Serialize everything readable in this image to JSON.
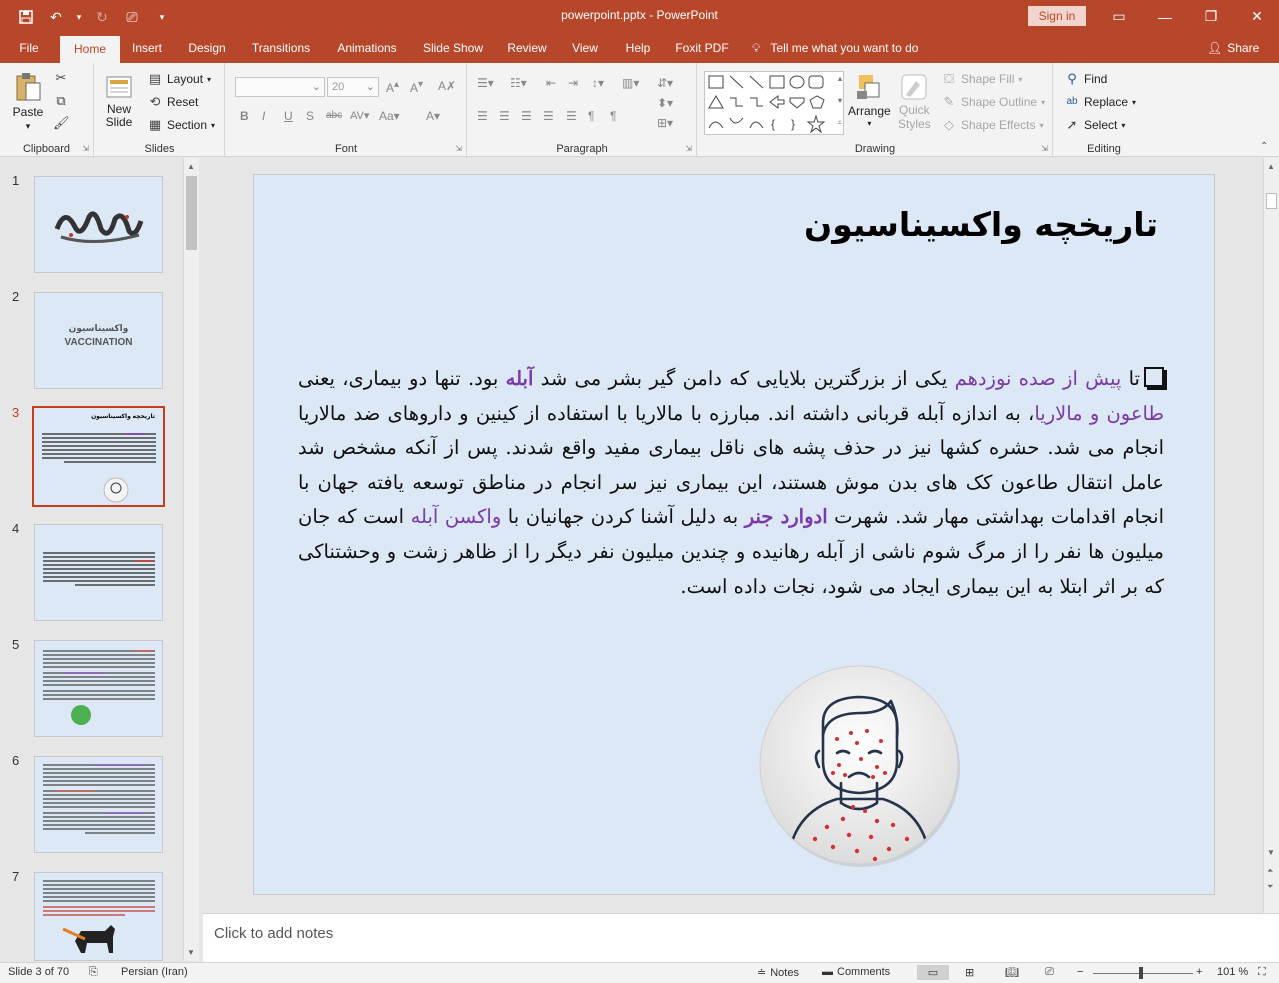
{
  "window": {
    "title": "powerpoint.pptx  -  PowerPoint",
    "signin_label": "Sign in"
  },
  "tabs": [
    "File",
    "Home",
    "Insert",
    "Design",
    "Transitions",
    "Animations",
    "Slide Show",
    "Review",
    "View",
    "Help",
    "Foxit PDF"
  ],
  "active_tab": "Home",
  "tellme": "Tell me what you want to do",
  "share_label": "Share",
  "ribbon": {
    "clipboard": {
      "label": "Clipboard",
      "paste": "Paste"
    },
    "slides": {
      "label": "Slides",
      "new_slide_1": "New",
      "new_slide_2": "Slide",
      "layout": "Layout",
      "reset": "Reset",
      "section": "Section"
    },
    "font": {
      "label": "Font",
      "font_name": "",
      "font_size": "20"
    },
    "paragraph": {
      "label": "Paragraph"
    },
    "drawing": {
      "label": "Drawing",
      "arrange": "Arrange",
      "quick_styles_1": "Quick",
      "quick_styles_2": "Styles",
      "shape_fill": "Shape Fill",
      "shape_outline": "Shape Outline",
      "shape_effects": "Shape Effects"
    },
    "editing": {
      "label": "Editing",
      "find": "Find",
      "replace": "Replace",
      "select": "Select"
    }
  },
  "thumbnails": [
    {
      "num": "1",
      "text": ""
    },
    {
      "num": "2",
      "text1": "واکسیناسیون",
      "text2": "VACCINATION"
    },
    {
      "num": "3",
      "text": "تاریخچه واکسیناسیون"
    },
    {
      "num": "4"
    },
    {
      "num": "5"
    },
    {
      "num": "6"
    },
    {
      "num": "7"
    }
  ],
  "selected_slide": "3",
  "slide": {
    "title": "تاریخچه واکسیناسیون",
    "body": {
      "p1": "تا ",
      "h1": "پیش از صده نوزدهم",
      "p2": " یکی از بزرگترین بلایایی که دامن گیر بشر می شد ",
      "h2": "آبله",
      "p3": " بود. تنها دو بیماری، یعنی ",
      "h3": "طاعون و مالاریا",
      "p4": "، به اندازه آبله قربانی داشته اند. مبارزه با مالاریا با استفاده از کینین و داروهای ضد مالاریا انجام می شد. حشره کشها نیز در حذف پشه های ناقل بیماری مفید واقع شدند. پس از آنکه مشخص شد عامل انتقال طاعون کک های بدن موش هستند، این بیماری نیز سر انجام در مناطق توسعه یافته جهان با انجام اقدامات بهداشتی مهار شد. شهرت ",
      "h4": "ادوارد جنر",
      "p5": " به دلیل آشنا کردن جهانیان با ",
      "h5": "واکسن آبله",
      "p6": " است که جان میلیون ها نفر را از مرگ شوم ناشی از آبله رهانیده و چندین میلیون نفر دیگر را از ظاهر زشت و وحشتناکی که بر اثر ابتلا به این بیماری ایجاد می شود، نجات داده است."
    }
  },
  "notes_placeholder": "Click to add notes",
  "status": {
    "slide_of": "Slide 3 of 70",
    "language": "Persian (Iran)",
    "notes": "Notes",
    "comments": "Comments",
    "zoom": "101 %"
  },
  "colors": {
    "accent": "#b7472a",
    "highlight_text": "#7a3aa8",
    "slide_bg": "#dce8f6"
  }
}
